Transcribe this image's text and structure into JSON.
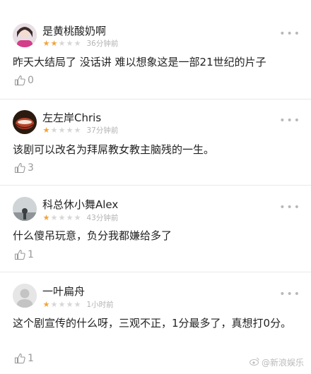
{
  "comments": [
    {
      "username": "是黄桃酸奶啊",
      "rating": 2,
      "time": "36分钟前",
      "text": "昨天大结局了 没话讲 难以想象这是一部21世纪的片子",
      "likes": "0"
    },
    {
      "username": "左左岸Chris",
      "rating": 1,
      "time": "37分钟前",
      "text": "该剧可以改名为拜屌教女教主脑残的一生。",
      "likes": "3"
    },
    {
      "username": "科总休小舞Alex",
      "rating": 1,
      "time": "43分钟前",
      "text": "什么傻吊玩意，负分我都嫌给多了",
      "likes": "1"
    },
    {
      "username": "一叶扁舟",
      "rating": 1,
      "time": "1小时前",
      "text": "这个剧宣传的什么呀，三观不正，1分最多了，真想打0分。",
      "likes": "1"
    }
  ],
  "more_glyph": "•••",
  "watermark": "@新浪娱乐",
  "colors": {
    "star_on": "#f2a33a",
    "star_off": "#d6d6d6",
    "meta": "#b3b3b3"
  },
  "icons": {
    "like": "thumbs-up-icon",
    "more": "more-dots-icon"
  }
}
